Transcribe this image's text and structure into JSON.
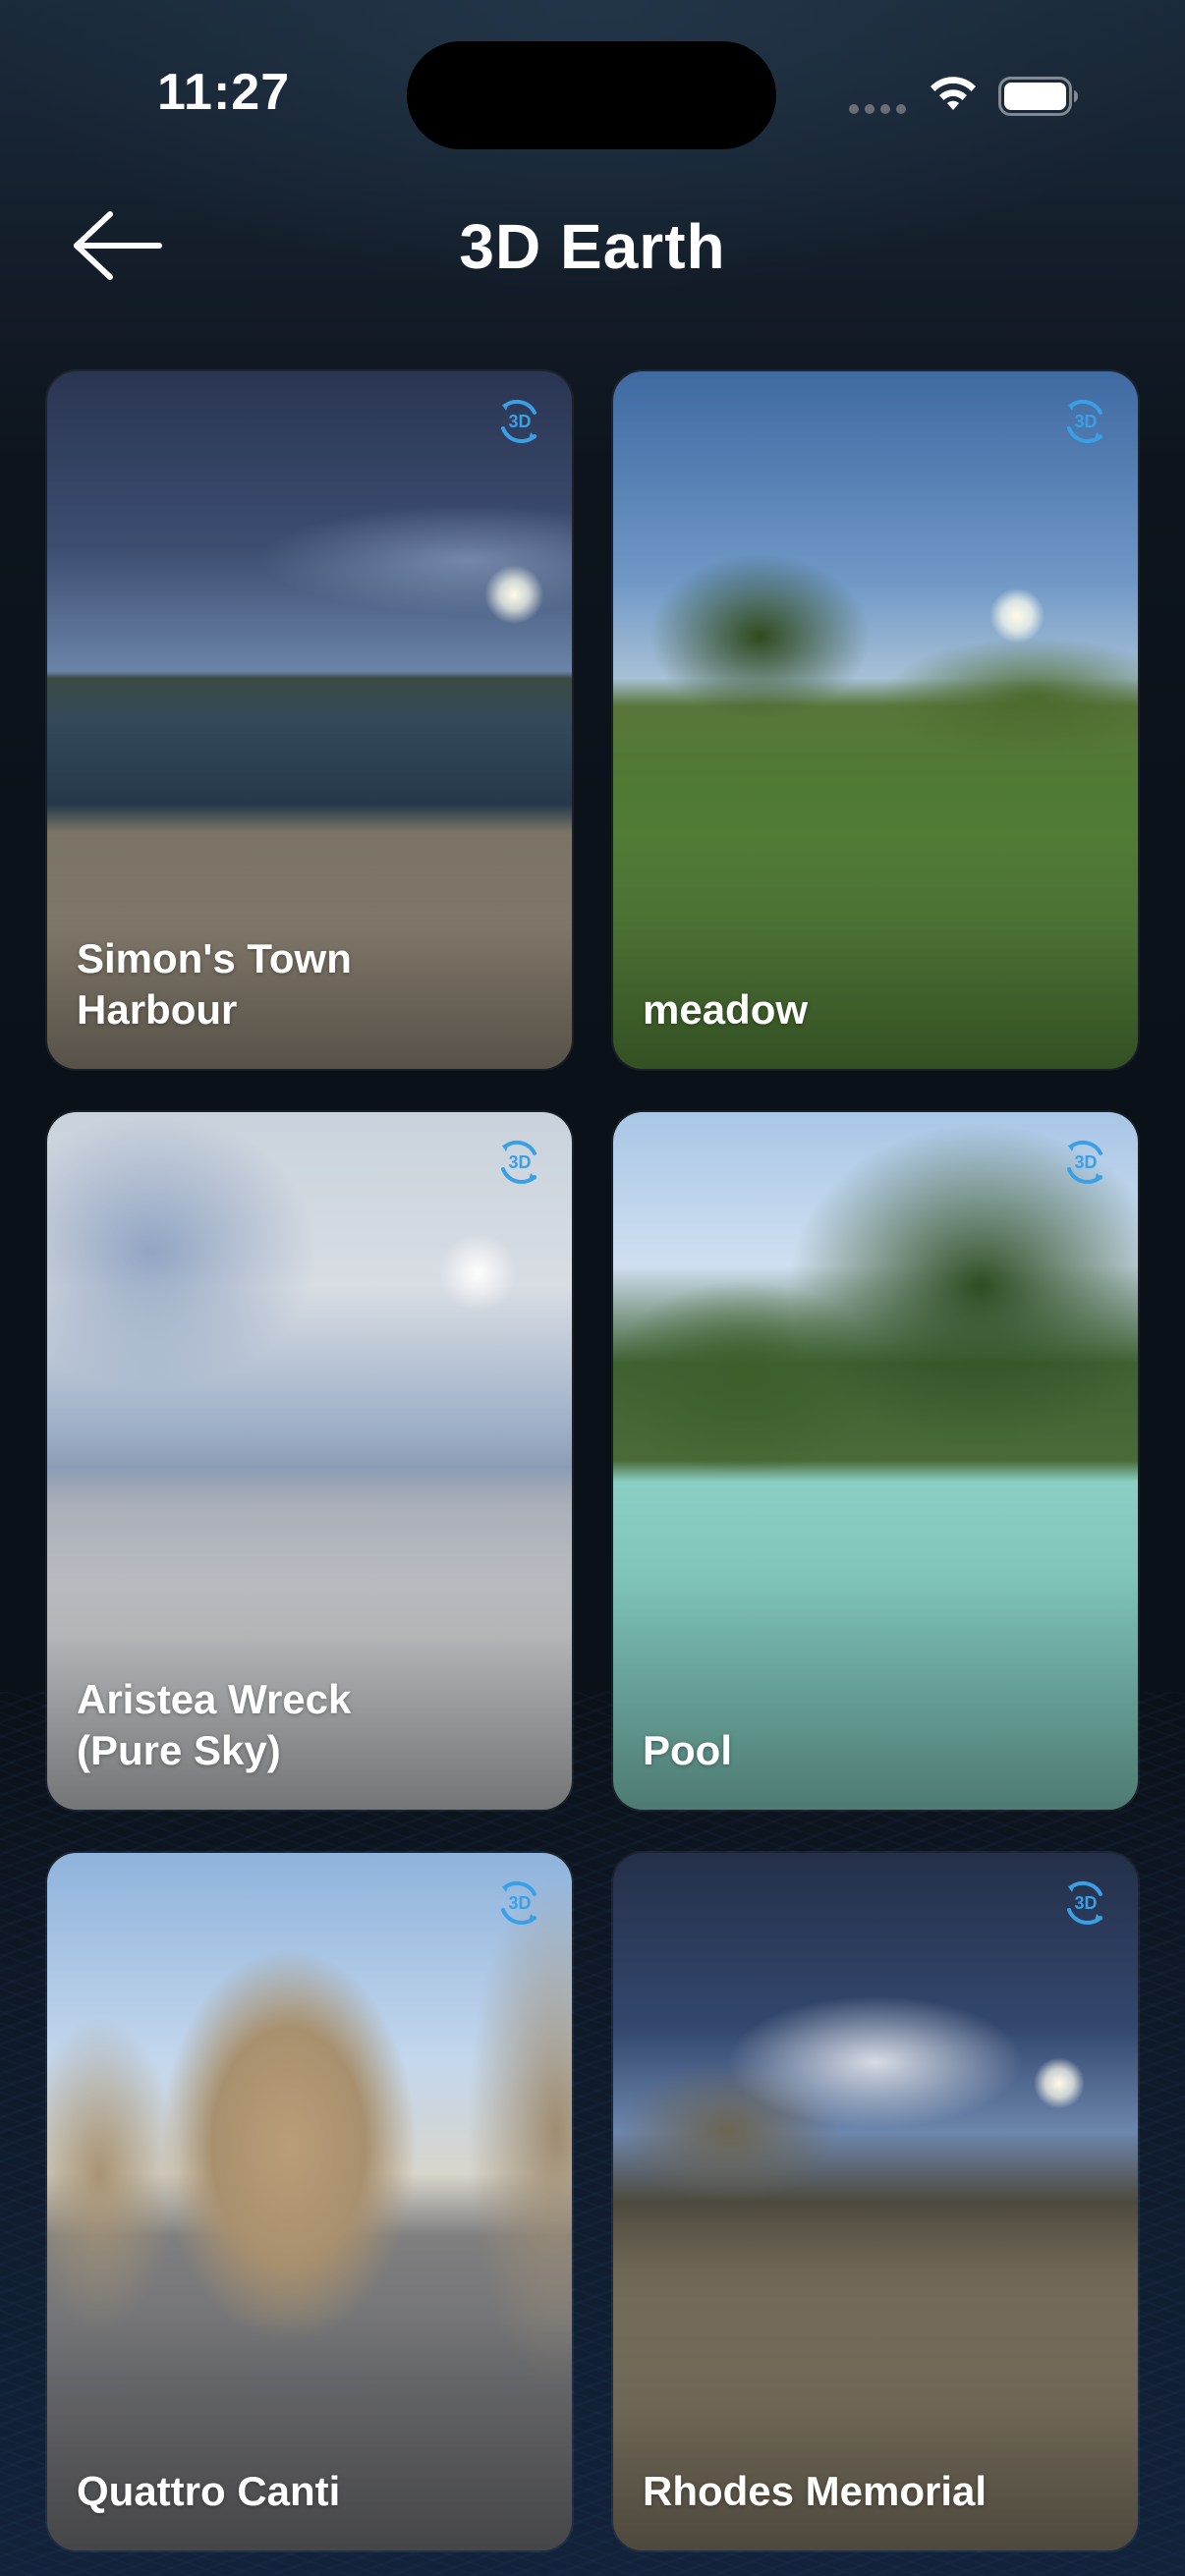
{
  "status_bar": {
    "time": "11:27"
  },
  "header": {
    "title": "3D Earth",
    "back_icon": "arrow-left-icon"
  },
  "badge": {
    "label": "3D",
    "icon": "rotate-3d-icon",
    "color": "#3aa0e6"
  },
  "cards": [
    {
      "label": "Simon's Town\nHarbour",
      "scene": "harbour"
    },
    {
      "label": "meadow",
      "scene": "meadow"
    },
    {
      "label": "Aristea Wreck\n(Pure Sky)",
      "scene": "pure-sky"
    },
    {
      "label": "Pool",
      "scene": "pool"
    },
    {
      "label": "Quattro Canti",
      "scene": "quattro"
    },
    {
      "label": "Rhodes Memorial",
      "scene": "rhodes"
    }
  ]
}
